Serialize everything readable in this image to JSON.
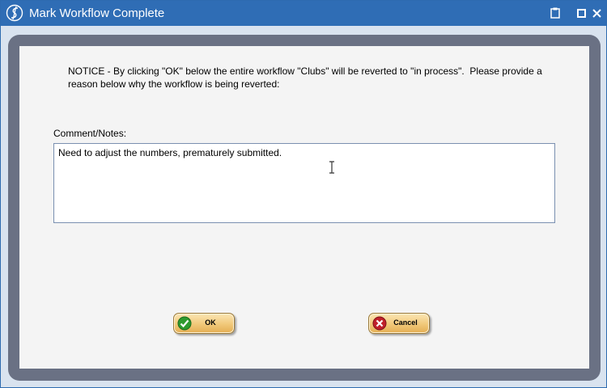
{
  "window": {
    "title": "Mark Workflow Complete",
    "app_icon": "s-logo-icon",
    "controls": [
      "clipboard-icon",
      "maximize-icon",
      "close-icon"
    ]
  },
  "notice": {
    "text": "NOTICE - By clicking \"OK\" below the entire workflow \"Clubs\" will be reverted to \"in process\".  Please provide a reason below why the workflow is being reverted:"
  },
  "comment": {
    "label": "Comment/Notes:",
    "value": "Need to adjust the numbers, prematurely submitted."
  },
  "buttons": {
    "ok": {
      "label": "OK",
      "icon": "check-icon",
      "color": "#2e9a2e"
    },
    "cancel": {
      "label": "Cancel",
      "icon": "cancel-x-icon",
      "color": "#c0202a"
    }
  },
  "colors": {
    "titlebar": "#2f6db5",
    "frame": "#6a7184",
    "panel": "#f4f4f4",
    "button": "#f1c879"
  }
}
